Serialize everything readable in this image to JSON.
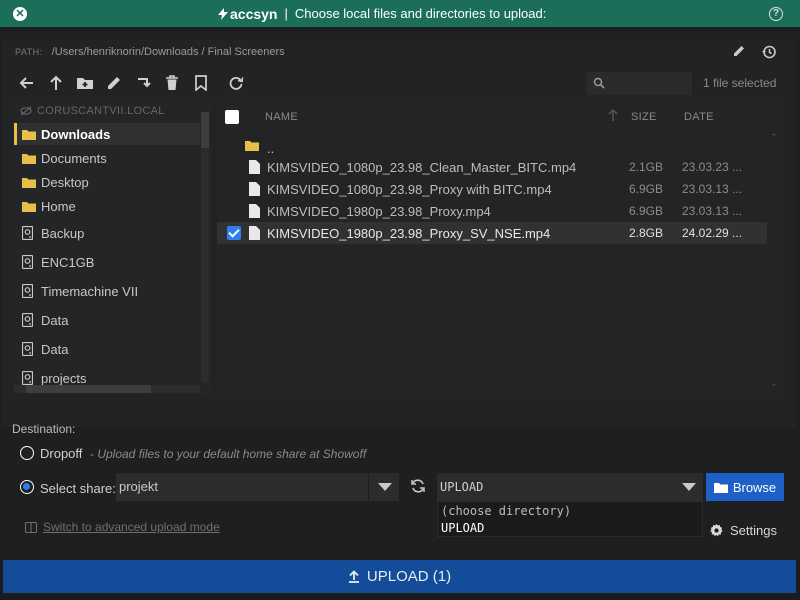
{
  "titlebar": {
    "brand": "accsyn",
    "separator": "|",
    "title": "Choose local files and directories to upload:",
    "close_icon": "close-icon",
    "help_icon": "help-icon"
  },
  "path": {
    "label": "PATH:",
    "value": "/Users/henriknorin/Downloads / Final Screeners"
  },
  "toolbar": {
    "icons": [
      "back-arrow-icon",
      "up-arrow-icon",
      "new-folder-icon",
      "rename-pencil-icon",
      "move-icon",
      "trash-icon",
      "bookmark-icon",
      "refresh-icon"
    ],
    "search_placeholder": "",
    "selection_count": "1 file selected"
  },
  "sidebar": {
    "host": "CORUSCANTVII.LOCAL",
    "items": [
      {
        "label": "Downloads",
        "icon": "folder-icon",
        "active": true
      },
      {
        "label": "Documents",
        "icon": "folder-icon"
      },
      {
        "label": "Desktop",
        "icon": "folder-icon"
      },
      {
        "label": "Home",
        "icon": "folder-icon"
      },
      {
        "label": "Backup",
        "icon": "drive-icon"
      },
      {
        "label": "ENC1GB",
        "icon": "drive-icon"
      },
      {
        "label": "Timemachine VII",
        "icon": "drive-icon"
      },
      {
        "label": "Data",
        "icon": "drive-icon"
      },
      {
        "label": "Data",
        "icon": "drive-icon"
      },
      {
        "label": "projects",
        "icon": "drive-icon"
      }
    ]
  },
  "filelist": {
    "columns": {
      "name": "NAME",
      "size": "SIZE",
      "date": "DATE"
    },
    "parent_dir": "..",
    "rows": [
      {
        "name": "KIMSVIDEO_1080p_23.98_Clean_Master_BITC.mp4",
        "size": "2.1GB",
        "date": "23.03.23 ...",
        "checked": false
      },
      {
        "name": "KIMSVIDEO_1080p_23.98_Proxy with BITC.mp4",
        "size": "6.9GB",
        "date": "23.03.13 ...",
        "checked": false
      },
      {
        "name": "KIMSVIDEO_1980p_23.98_Proxy.mp4",
        "size": "6.9GB",
        "date": "23.03.13 ...",
        "checked": false
      },
      {
        "name": "KIMSVIDEO_1980p_23.98_Proxy_SV_NSE.mp4",
        "size": "2.8GB",
        "date": "24.02.29 ...",
        "checked": true
      }
    ]
  },
  "destination": {
    "label": "Destination:",
    "dropoff_label": "Dropoff",
    "dropoff_hint": "- Upload files to your default home share at Showoff",
    "select_share_label": "Select share:",
    "share_value": "projekt",
    "directory_value": "UPLOAD",
    "directory_options": [
      "(choose directory)",
      "UPLOAD"
    ],
    "browse_label": "Browse",
    "settings_label": "Settings",
    "advanced_link": "Switch to advanced upload mode"
  },
  "upload_button": "UPLOAD (1)",
  "colors": {
    "titlebar": "#1b6e5a",
    "accent_blue": "#1f5fc8",
    "upload_bar": "#154c99",
    "folder": "#e6c04a"
  }
}
